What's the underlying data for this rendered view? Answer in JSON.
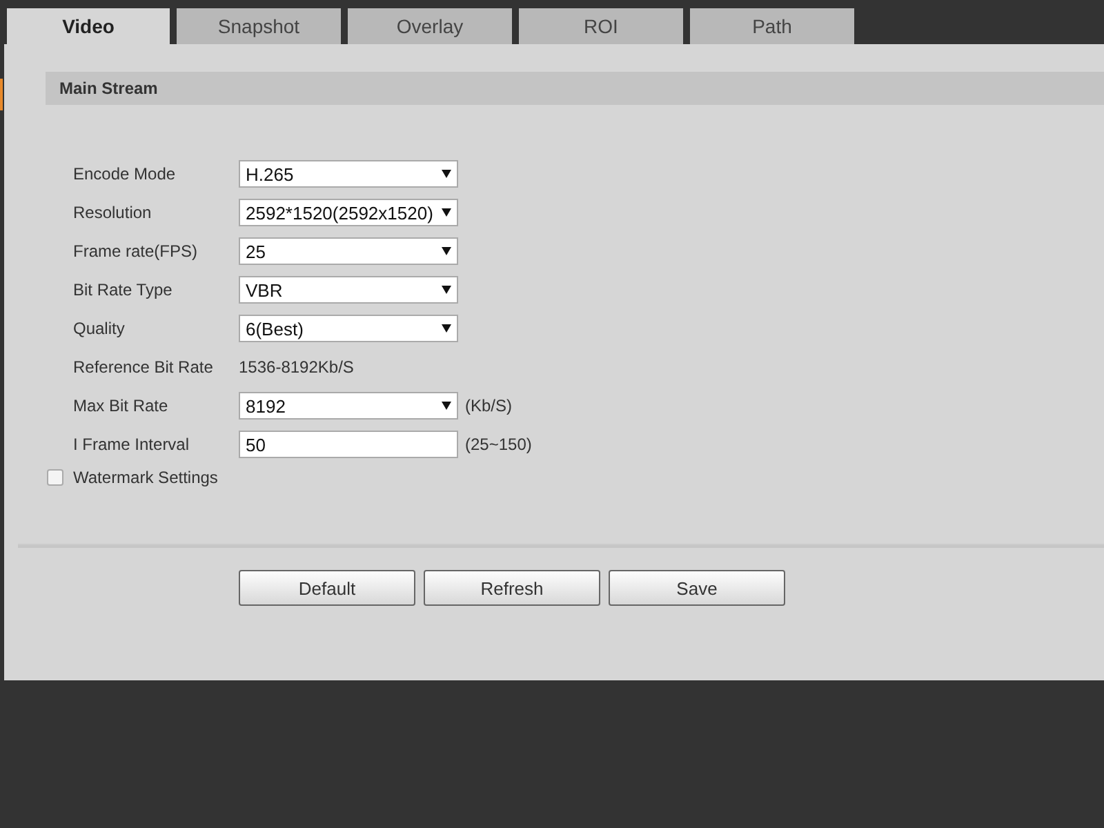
{
  "tabs": [
    {
      "label": "Video",
      "selected": true
    },
    {
      "label": "Snapshot",
      "selected": false
    },
    {
      "label": "Overlay",
      "selected": false
    },
    {
      "label": "ROI",
      "selected": false
    },
    {
      "label": "Path",
      "selected": false
    }
  ],
  "section": {
    "title": "Main Stream"
  },
  "fields": [
    {
      "kind": "select",
      "label": "Encode Mode",
      "value": "H.265"
    },
    {
      "kind": "select",
      "label": "Resolution",
      "value": "2592*1520(2592x1520)"
    },
    {
      "kind": "select",
      "label": "Frame rate(FPS)",
      "value": "25"
    },
    {
      "kind": "select",
      "label": "Bit Rate Type",
      "value": "VBR"
    },
    {
      "kind": "select",
      "label": "Quality",
      "value": "6(Best)"
    },
    {
      "kind": "text",
      "label": "Reference Bit Rate",
      "value": "1536-8192Kb/S"
    },
    {
      "kind": "select",
      "label": "Max Bit Rate",
      "value": "8192",
      "unit": "(Kb/S)"
    },
    {
      "kind": "input",
      "label": "I Frame Interval",
      "value": "50",
      "unit": "(25~150)"
    }
  ],
  "watermark": {
    "label": "Watermark Settings",
    "checked": false
  },
  "buttons": [
    "Default",
    "Refresh",
    "Save"
  ]
}
